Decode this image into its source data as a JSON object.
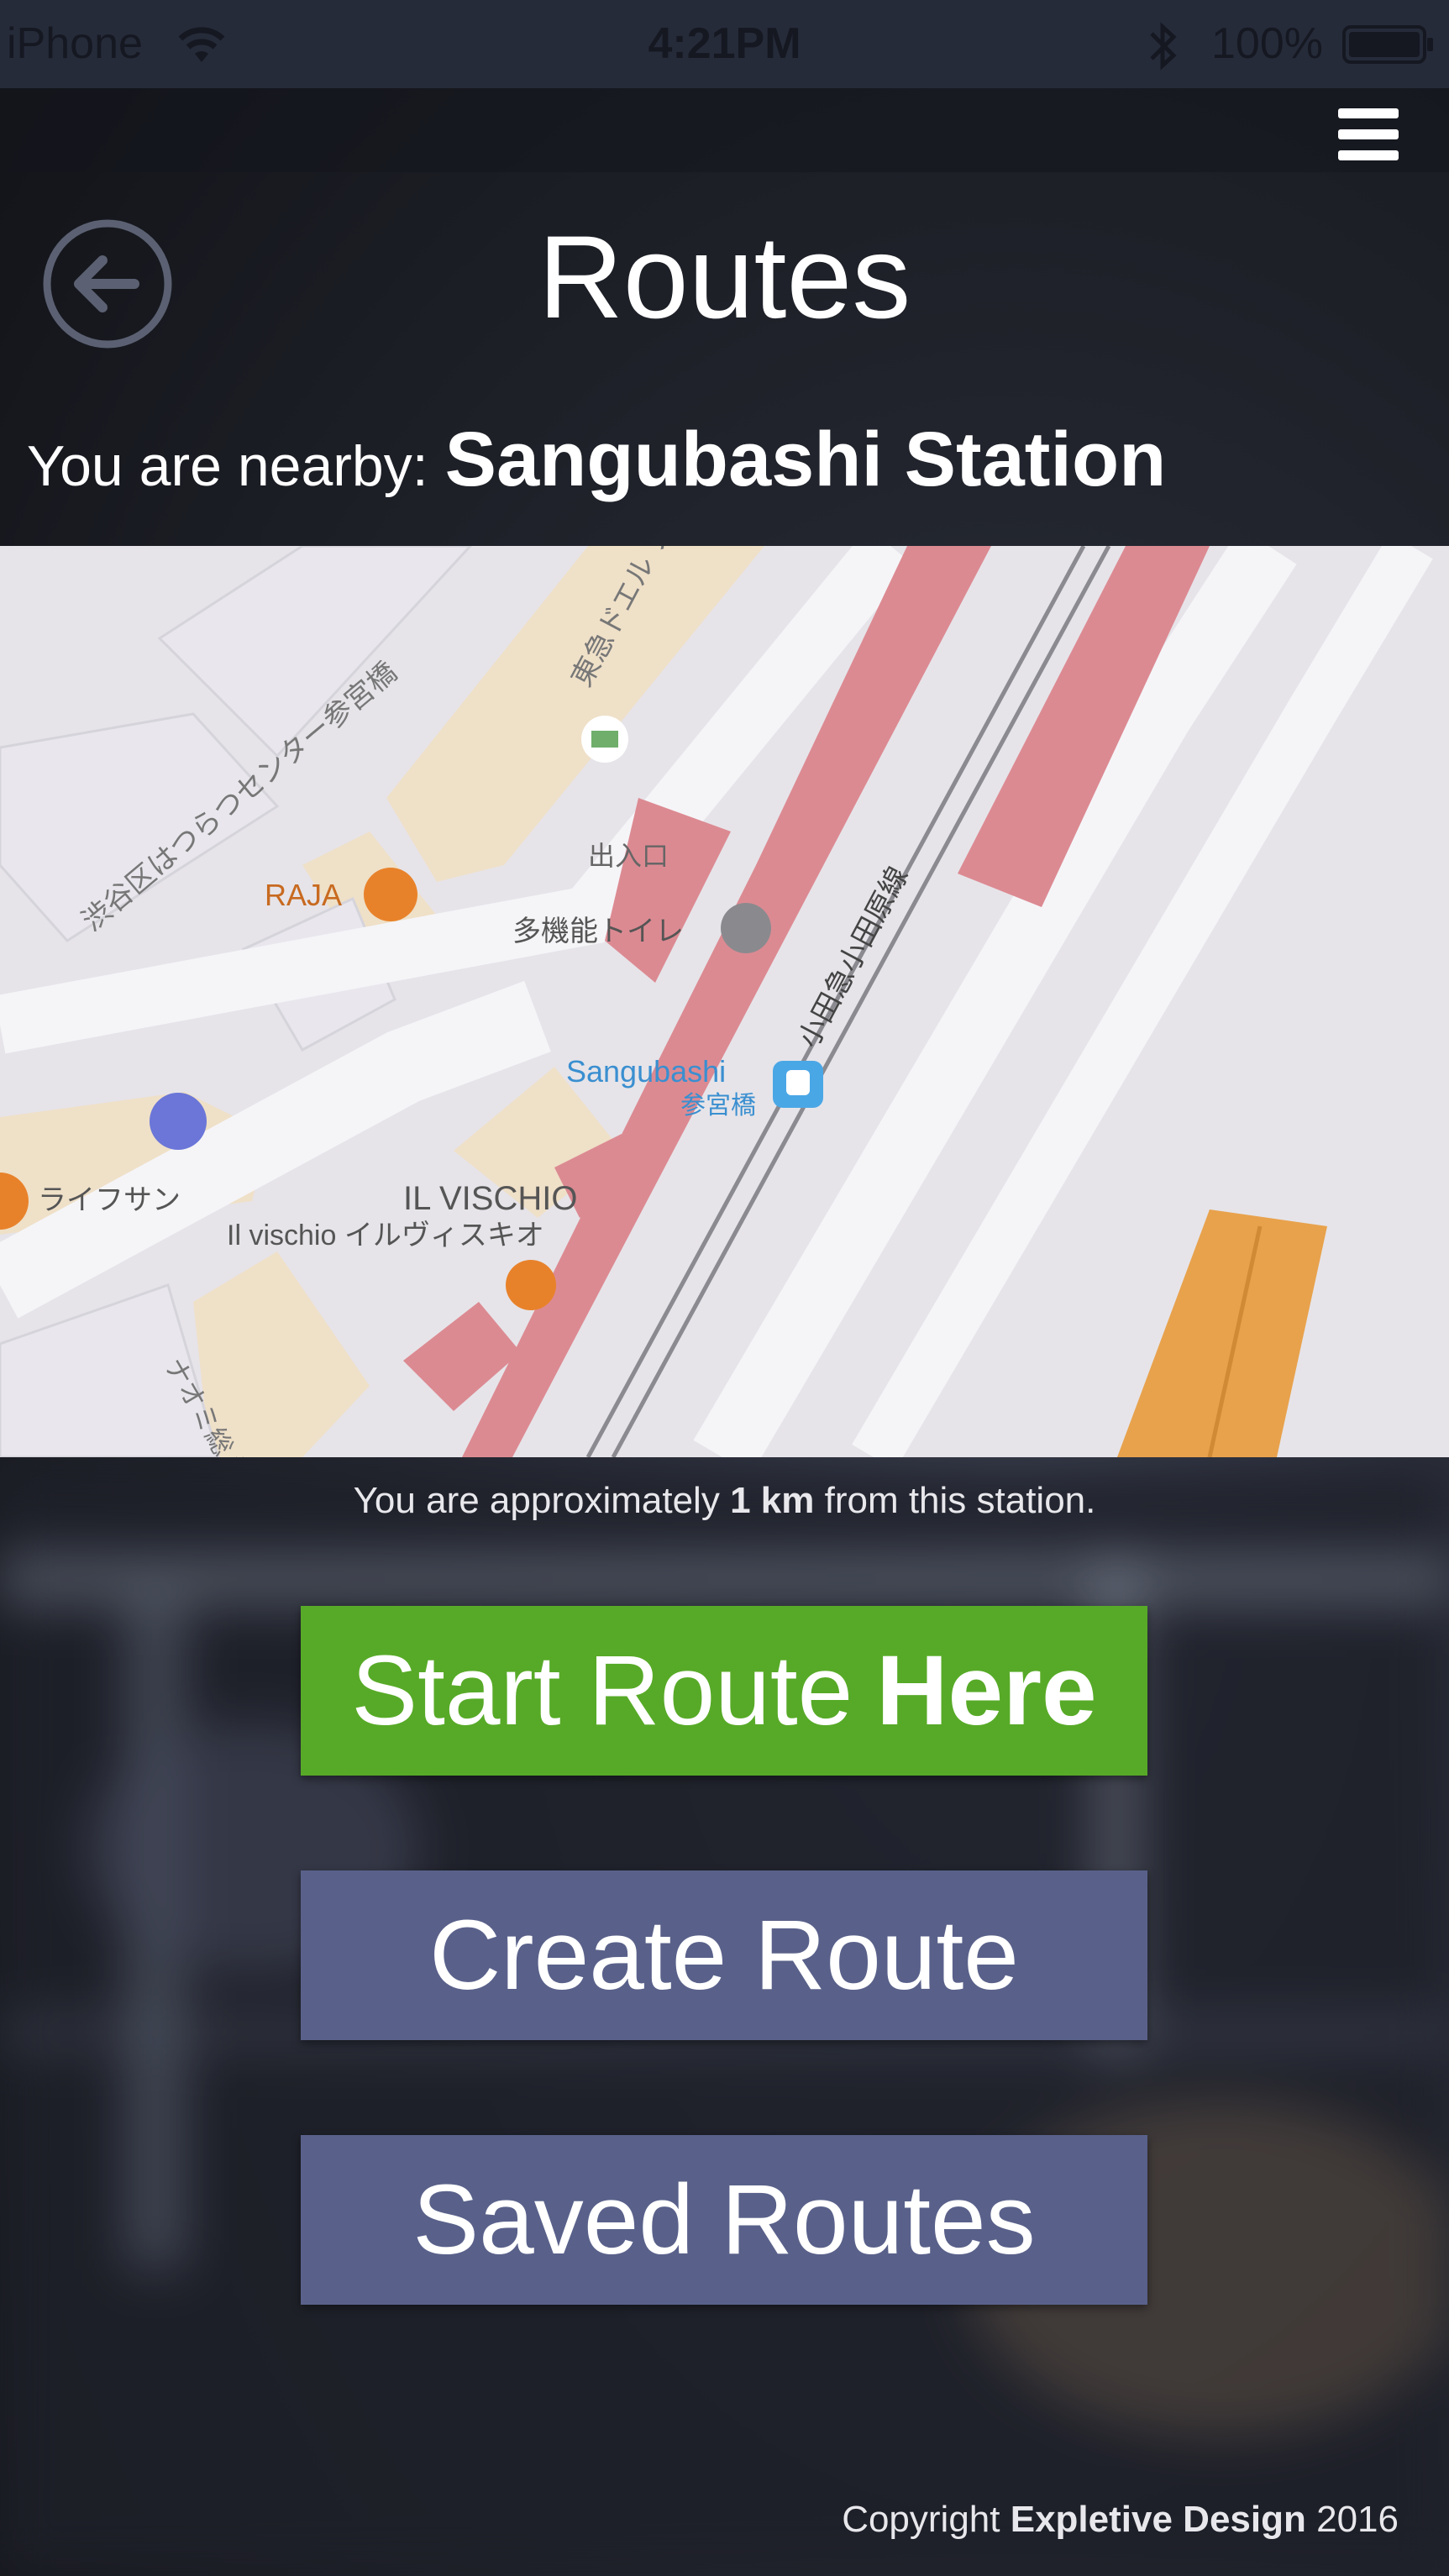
{
  "status_bar": {
    "carrier": "iPhone",
    "time": "4:21PM",
    "battery": "100%",
    "icons": [
      "wifi-icon",
      "bluetooth-icon",
      "battery-icon"
    ]
  },
  "header": {
    "title": "Routes",
    "icons": [
      "back-arrow-icon",
      "hamburger-menu-icon"
    ]
  },
  "nearby": {
    "label": "You are nearby:",
    "station": "Sangubashi Station"
  },
  "map": {
    "labels": {
      "station_en": "Sangubashi",
      "station_jp": "参宮橋",
      "line": "小田急小田原線",
      "entrance": "出入口",
      "toilet": "多機能トイレ",
      "raja": "RAJA",
      "vischio": "IL VISCHIO",
      "vischio_sub": "Il vischio イルヴィスキオ",
      "lifesun": "ライフサン",
      "center": "渋谷区はつらつセンター参宮橋",
      "prestage": "東急ドエル プレステージ",
      "naomi": "ナオミ総 摘ビル"
    },
    "colors": {
      "land": "#e6e4e9",
      "road": "#f5f5f8",
      "building": "#efe0c8",
      "station": "#dc8a92",
      "highlight": "#e8a24c",
      "poi": "#e8822a"
    }
  },
  "distance": {
    "prefix": "You are approximately",
    "value": "1 km",
    "suffix": "from this station."
  },
  "buttons": {
    "start_prefix": "Start Route",
    "start_bold": "Here",
    "create": "Create Route",
    "saved": "Saved Routes"
  },
  "footer": {
    "prefix": "Copyright",
    "company": "Expletive Design",
    "year": "2016"
  }
}
